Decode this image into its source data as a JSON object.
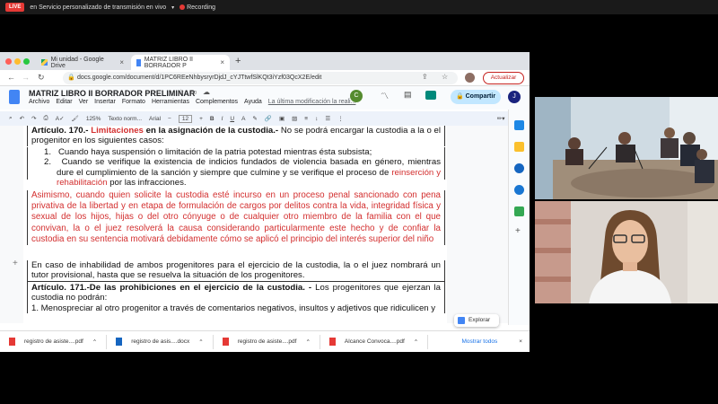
{
  "stream": {
    "live_label": "LIVE",
    "title": "en Servicio personalizado de transmisión en vivo",
    "recording_label": "Recording"
  },
  "browser": {
    "tabs": [
      {
        "label": "Mi unidad - Google Drive"
      },
      {
        "label": "MATRIZ LIBRO II BORRADOR P"
      }
    ],
    "url": "docs.google.com/document/d/1PC6REeNhbysryrDjdJ_cYJTtwfSlKQt3iYzf03QcX2E/edit",
    "update_button": "Actualizar"
  },
  "docs": {
    "title": "MATRIZ LIBRO II BORRADOR PRELIMINAR",
    "menu": [
      "Archivo",
      "Editar",
      "Ver",
      "Insertar",
      "Formato",
      "Herramientas",
      "Complementos",
      "Ayuda"
    ],
    "last_edit": "La última modificación la reali...",
    "share_label": "Compartir",
    "avatar_initial": "J",
    "collab_initial": "C",
    "toolbar": {
      "zoom": "125%",
      "style": "Texto norm...",
      "font": "Arial",
      "font_size": "12"
    },
    "explore_label": "Explorar"
  },
  "document": {
    "p1_head": "Artículo. 170.-",
    "p1_red": " Limitaciones",
    "p1_bold": " en la asignación de la custodia.-",
    "p1_rest": " No se podrá encargar la custodia a la o el progenitor en los siguientes casos:",
    "item1": "Cuando haya suspensión o limitación de la patria potestad mientras ésta subsista;",
    "item2_a": "Cuando se verifique la existencia de indicios fundados de violencia basada en género, mientras dure el cumplimiento de la sanción y siempre que culmine y se verifique el proceso de ",
    "item2_red": "reinserción y rehabilitación",
    "item2_b": " por las infracciones.",
    "red_para": "Asimismo, cuando quien solicite la custodia esté incurso en un proceso penal sancionado con pena privativa de la libertad y en etapa de formulación de cargos por delitos contra la vida, integridad física y sexual de los hijos, hijas o del otro cónyuge o de cualquier otro miembro de la familia con el que convivan, la o el juez resolverá la causa considerando particularmente este hecho y de confiar la custodia en su sentencia motivará debidamente cómo se aplicó el principio del interés superior del niño",
    "p3": "En caso de inhabilidad de ambos progenitores para el ejercicio de la custodia, la o el juez nombrará un tutor provisional, hasta que se resuelva la situación de los progenitores.",
    "p4_bold": "Artículo. 171.-De las prohibiciones en el ejercicio de la custodia. -",
    "p4_rest": " Los progenitores que ejerzan la custodia no podrán:",
    "p4_item1": "1. Menospreciar al otro progenitor a través de comentarios negativos, insultos y adjetivos que ridiculicen y"
  },
  "downloads": {
    "items": [
      {
        "name": "registro de asiste....pdf",
        "kind": "pdf"
      },
      {
        "name": "registro de asis....docx",
        "kind": "docx"
      },
      {
        "name": "registro de asiste....pdf",
        "kind": "pdf"
      },
      {
        "name": "Alcance Convoca....pdf",
        "kind": "pdf"
      }
    ],
    "show_all": "Mostrar todos"
  }
}
